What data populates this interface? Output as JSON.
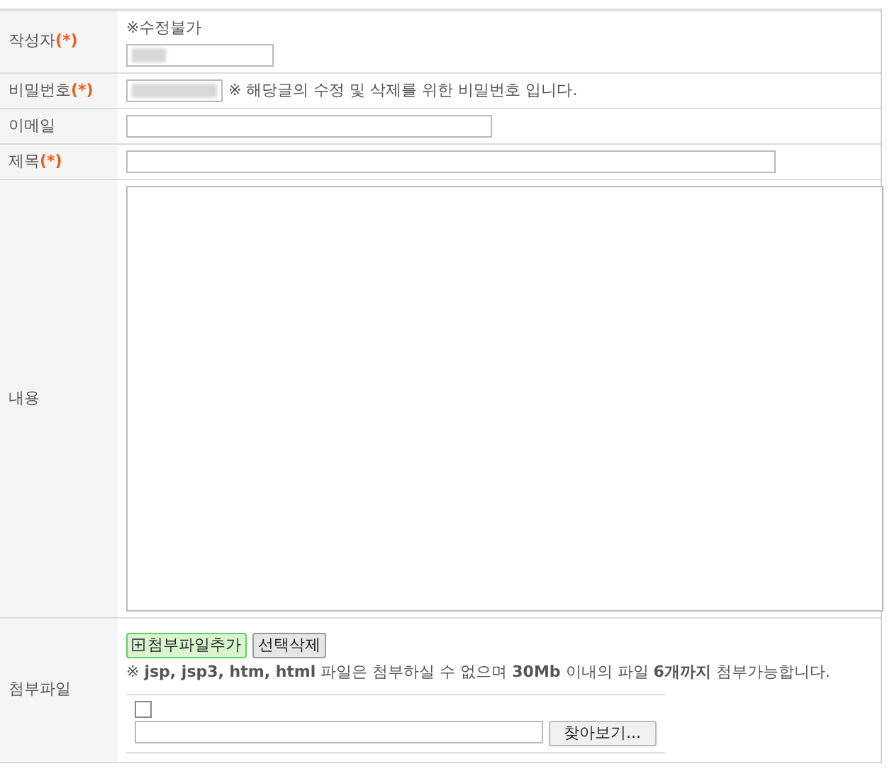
{
  "rows": [
    {
      "kind": "author",
      "label": "작성자",
      "required_mark": "(*)",
      "note": "※수정불가"
    },
    {
      "kind": "password",
      "label": "비밀번호",
      "required_mark": "(*)",
      "note": "※ 해당글의 수정 및 삭제를 위한 비밀번호 입니다."
    },
    {
      "kind": "short_text",
      "label": "이메일"
    },
    {
      "kind": "long_text",
      "label": "제목",
      "required_mark": "(*)"
    },
    {
      "kind": "textarea",
      "label": "내용"
    },
    {
      "kind": "attach",
      "label": "첨부파일",
      "add_button": "첨부파일추가",
      "add_icon": "+",
      "delete_button": "선택삭제",
      "note": "※ **jsp, jsp3, htm, html** 파일은 첨부하실 수 없으며 **30Mb** 이내의 파일 **6개까지** 첨부가능합니다.",
      "file": {
        "checked": false,
        "browse_button": "찾아보기..."
      }
    }
  ]
}
